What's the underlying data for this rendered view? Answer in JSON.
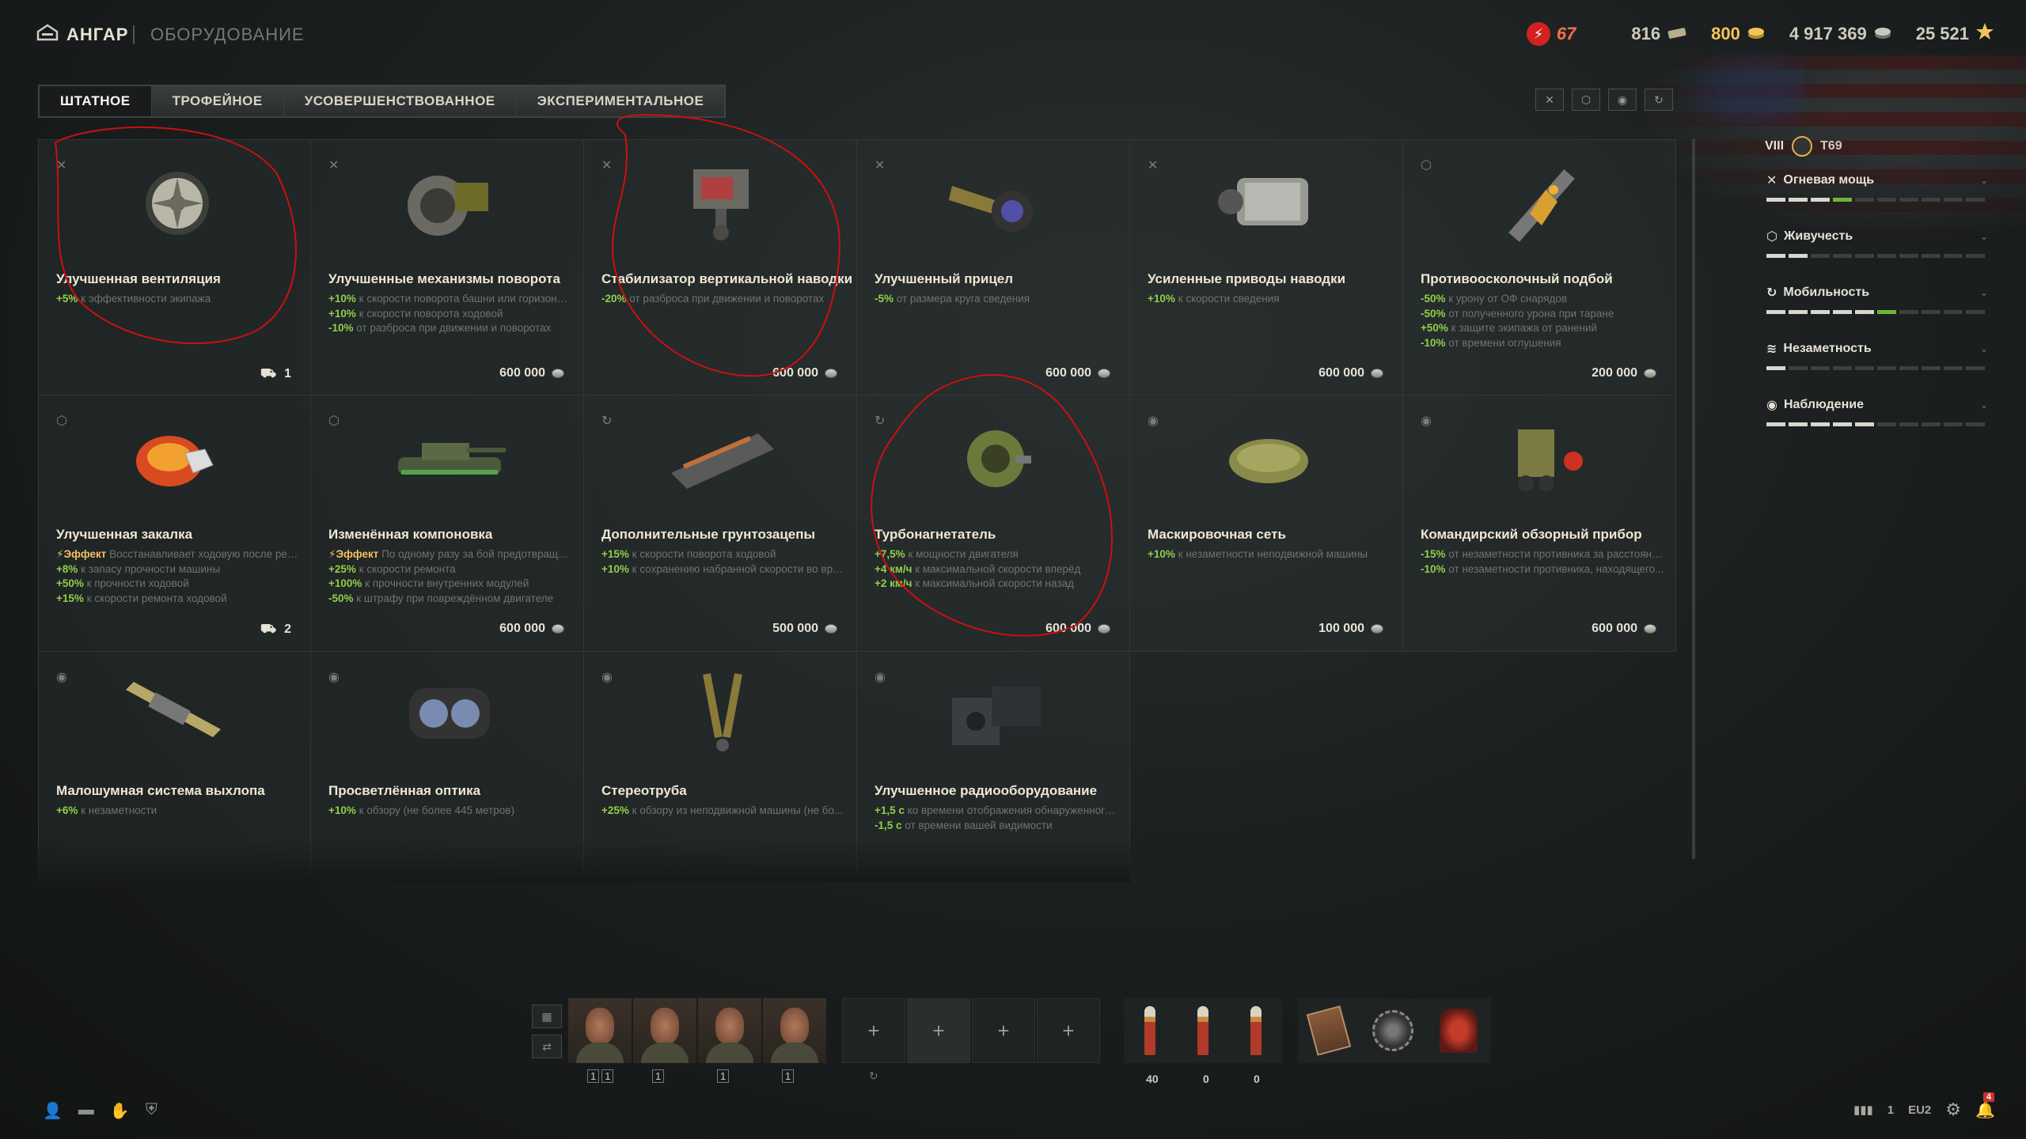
{
  "topbar": {
    "hangar_label": "АНГАР",
    "breadcrumb_current": "ОБОРУДОВАНИЕ",
    "boost_value": "67",
    "bonds": "816",
    "gold": "800",
    "credits": "4 917 369",
    "free_xp": "25 521"
  },
  "tabs": [
    {
      "label": "ШТАТНОЕ",
      "active": true
    },
    {
      "label": "ТРОФЕЙНОЕ",
      "active": false
    },
    {
      "label": "УСОВЕРШЕНСТВОВАННОЕ",
      "active": false
    },
    {
      "label": "ЭКСПЕРИМЕНТАЛЬНОЕ",
      "active": false
    }
  ],
  "filters": [
    "firepower-filter-icon",
    "survivability-filter-icon",
    "spotting-filter-icon",
    "mobility-filter-icon"
  ],
  "cards": [
    {
      "title": "Улучшенная вентиляция",
      "type_icon": "multi-category-icon",
      "bonuses": [
        {
          "v": "+5%",
          "t": " к эффективности экипажа"
        }
      ],
      "inventory": "1"
    },
    {
      "title": "Улучшенные механизмы поворота",
      "type_icon": "firepower-icon",
      "bonuses": [
        {
          "v": "+10%",
          "t": " к скорости поворота башни или горизонта..."
        },
        {
          "v": "+10%",
          "t": " к скорости поворота ходовой"
        },
        {
          "v": "-10%",
          "t": " от разброса при движении и поворотах"
        }
      ],
      "price": "600 000"
    },
    {
      "title": "Стабилизатор вертикальной наводки",
      "type_icon": "firepower-icon",
      "bonuses": [
        {
          "v": "-20%",
          "t": " от разброса при движении и поворотах"
        }
      ],
      "price": "600 000"
    },
    {
      "title": "Улучшенный прицел",
      "type_icon": "firepower-icon",
      "bonuses": [
        {
          "v": "-5%",
          "t": " от размера круга сведения"
        }
      ],
      "price": "600 000"
    },
    {
      "title": "Усиленные приводы наводки",
      "type_icon": "firepower-icon",
      "bonuses": [
        {
          "v": "+10%",
          "t": " к скорости сведения"
        }
      ],
      "price": "600 000"
    },
    {
      "title": "Противоосколочный подбой",
      "type_icon": "survivability-icon",
      "bonuses": [
        {
          "v": "-50%",
          "t": " к урону от ОФ снарядов"
        },
        {
          "v": "-50%",
          "t": " от полученного урона при таране"
        },
        {
          "v": "+50%",
          "t": " к защите экипажа от ранений"
        },
        {
          "v": "-10%",
          "t": " от времени оглушения"
        }
      ],
      "price": "200 000"
    },
    {
      "title": "Улучшенная закалка",
      "type_icon": "survivability-icon",
      "bonuses": [
        {
          "fx": "Эффект",
          "t": " Восстанавливает ходовую после ремо..."
        },
        {
          "v": "+8%",
          "t": " к запасу прочности машины"
        },
        {
          "v": "+50%",
          "t": " к прочности ходовой"
        },
        {
          "v": "+15%",
          "t": " к скорости ремонта ходовой"
        }
      ],
      "inventory": "2"
    },
    {
      "title": "Изменённая компоновка",
      "type_icon": "survivability-icon",
      "bonuses": [
        {
          "fx": "Эффект",
          "t": " По одному разу за бой предотвращае..."
        },
        {
          "v": "+25%",
          "t": " к скорости ремонта"
        },
        {
          "v": "+100%",
          "t": " к прочности внутренних модулей"
        },
        {
          "v": "-50%",
          "t": " к штрафу при повреждённом двигателе"
        }
      ],
      "price": "600 000"
    },
    {
      "title": "Дополнительные грунтозацепы",
      "type_icon": "mobility-icon",
      "bonuses": [
        {
          "v": "+15%",
          "t": " к скорости поворота ходовой"
        },
        {
          "v": "+10%",
          "t": " к сохранению набранной скорости во вре..."
        }
      ],
      "price": "500 000"
    },
    {
      "title": "Турбонагнетатель",
      "type_icon": "mobility-icon",
      "bonuses": [
        {
          "v": "+7,5%",
          "t": " к мощности двигателя"
        },
        {
          "v": "+4 км/ч",
          "t": " к максимальной скорости вперёд"
        },
        {
          "v": "+2 км/ч",
          "t": " к максимальной скорости назад"
        }
      ],
      "price": "600 000"
    },
    {
      "title": "Маскировочная сеть",
      "type_icon": "spotting-icon",
      "bonuses": [
        {
          "v": "+10%",
          "t": " к незаметности неподвижной машины"
        }
      ],
      "price": "100 000"
    },
    {
      "title": "Командирский обзорный прибор",
      "type_icon": "spotting-icon",
      "bonuses": [
        {
          "v": "-15%",
          "t": " от незаметности противника за расстоянием..."
        },
        {
          "v": "-10%",
          "t": " от незаметности противника, находящего..."
        }
      ],
      "price": "600 000"
    },
    {
      "title": "Малошумная система выхлопа",
      "type_icon": "spotting-icon",
      "bonuses": [
        {
          "v": "+6%",
          "t": " к незаметности"
        }
      ]
    },
    {
      "title": "Просветлённая оптика",
      "type_icon": "spotting-icon",
      "bonuses": [
        {
          "v": "+10%",
          "t": " к обзору (не более 445 метров)"
        }
      ]
    },
    {
      "title": "Стереотруба",
      "type_icon": "spotting-icon",
      "bonuses": [
        {
          "v": "+25%",
          "t": " к обзору из неподвижной машины (не бо..."
        }
      ]
    },
    {
      "title": "Улучшенное радиооборудование",
      "type_icon": "spotting-icon",
      "bonuses": [
        {
          "v": "+1,5 с",
          "t": " ко времени отображения обнаруженного ..."
        },
        {
          "v": "-1,5 с",
          "t": " от времени вашей видимости"
        }
      ]
    }
  ],
  "tank": {
    "tier": "VIII",
    "name": "T69"
  },
  "stats": [
    {
      "label": "Огневая мощь",
      "icon": "firepower-icon",
      "filled": 3,
      "green": 1
    },
    {
      "label": "Живучесть",
      "icon": "survivability-icon",
      "filled": 2,
      "green": 0
    },
    {
      "label": "Мобильность",
      "icon": "mobility-icon",
      "filled": 5,
      "green": 1
    },
    {
      "label": "Незаметность",
      "icon": "camouflage-icon",
      "filled": 1,
      "green": 0
    },
    {
      "label": "Наблюдение",
      "icon": "spotting-icon",
      "filled": 5,
      "green": 0
    }
  ],
  "crew_levels": [
    [
      "1",
      "1"
    ],
    [
      "1"
    ],
    [
      "1"
    ],
    [
      "1"
    ]
  ],
  "equipment_slots": [
    "+",
    "+",
    "+",
    "+"
  ],
  "ammo_counts": [
    "40",
    "0",
    "0"
  ],
  "bottom": {
    "battle_count": "1",
    "server": "EU2",
    "notification_count": "4"
  },
  "annotation_color": "#cc1010"
}
